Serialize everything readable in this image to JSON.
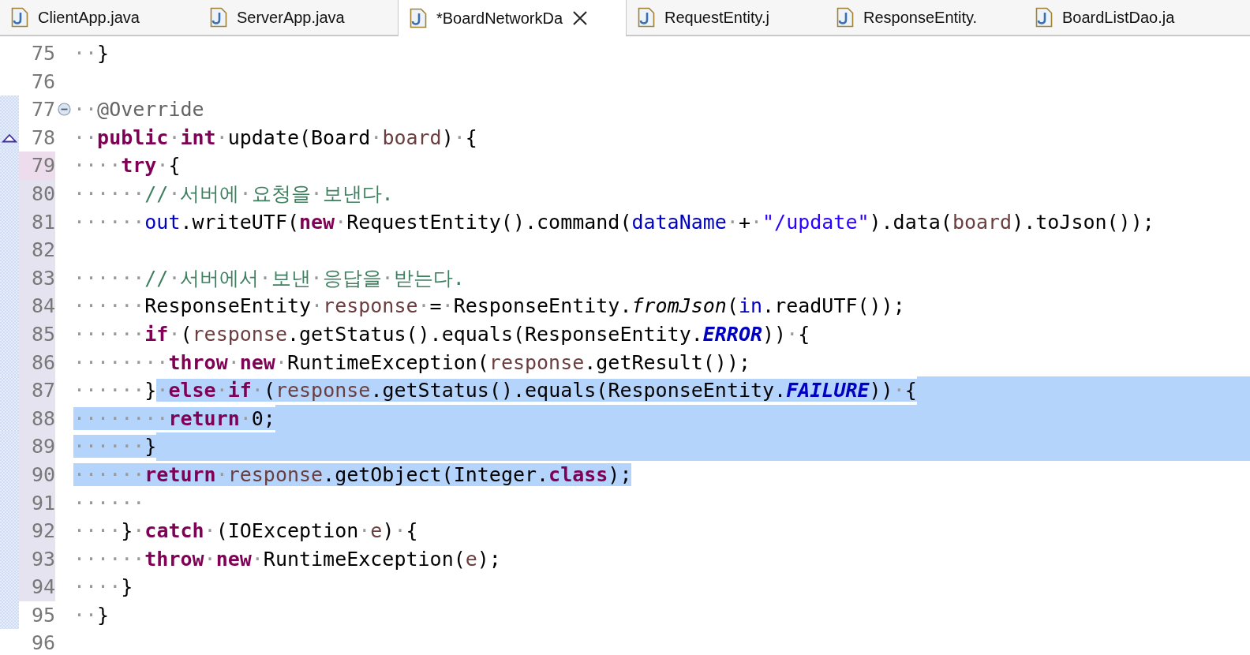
{
  "editor_tabs": [
    {
      "label": "ClientApp.java",
      "selected": false
    },
    {
      "label": "ServerApp.java",
      "selected": false
    },
    {
      "label": "*BoardNetworkDa",
      "selected": true
    },
    {
      "label": "RequestEntity.j",
      "selected": false
    },
    {
      "label": "ResponseEntity.",
      "selected": false
    },
    {
      "label": "BoardListDao.ja",
      "selected": false
    }
  ],
  "lines": [
    {
      "number": "75",
      "changed": false,
      "current": false,
      "range": false,
      "foldable": false,
      "override": false,
      "selected_to_end": false,
      "tokens": [
        {
          "kind": "plain",
          "text": "··}"
        }
      ]
    },
    {
      "number": "76",
      "changed": false,
      "current": false,
      "range": false,
      "foldable": false,
      "override": false,
      "selected_to_end": false
    },
    {
      "number": "77",
      "changed": false,
      "current": false,
      "range": true,
      "foldable": true,
      "override": false,
      "selected_to_end": false,
      "tokens": [
        {
          "kind": "plain",
          "text": "··"
        },
        {
          "kind": "annotation",
          "text": "@Override"
        }
      ]
    },
    {
      "number": "78",
      "changed": false,
      "current": false,
      "range": true,
      "foldable": false,
      "override": true,
      "selected_to_end": false,
      "tokens": [
        {
          "kind": "plain",
          "text": "··"
        },
        {
          "kind": "keyword",
          "text": "public"
        },
        {
          "kind": "plain",
          "text": "·"
        },
        {
          "kind": "keyword",
          "text": "int"
        },
        {
          "kind": "plain",
          "text": "·update(Board·"
        },
        {
          "kind": "local",
          "text": "board"
        },
        {
          "kind": "plain",
          "text": ")·{"
        }
      ]
    },
    {
      "number": "79",
      "changed": true,
      "current": true,
      "range": true,
      "foldable": false,
      "override": false,
      "selected_to_end": false,
      "tokens": [
        {
          "kind": "plain",
          "text": "····"
        },
        {
          "kind": "keyword",
          "text": "try"
        },
        {
          "kind": "plain",
          "text": "·{"
        }
      ]
    },
    {
      "number": "80",
      "changed": true,
      "current": false,
      "range": true,
      "foldable": false,
      "override": false,
      "selected_to_end": false,
      "tokens": [
        {
          "kind": "plain",
          "text": "······"
        },
        {
          "kind": "comment",
          "text": "//·서버에·요청을·보낸다."
        }
      ]
    },
    {
      "number": "81",
      "changed": true,
      "current": false,
      "range": true,
      "foldable": false,
      "override": false,
      "selected_to_end": false,
      "tokens": [
        {
          "kind": "plain",
          "text": "······"
        },
        {
          "kind": "field",
          "text": "out"
        },
        {
          "kind": "plain",
          "text": ".writeUTF("
        },
        {
          "kind": "keyword",
          "text": "new"
        },
        {
          "kind": "plain",
          "text": "·RequestEntity().command("
        },
        {
          "kind": "field",
          "text": "dataName"
        },
        {
          "kind": "plain",
          "text": "·+·"
        },
        {
          "kind": "string",
          "text": "\"/update\""
        },
        {
          "kind": "plain",
          "text": ").data("
        },
        {
          "kind": "local",
          "text": "board"
        },
        {
          "kind": "plain",
          "text": ").toJson());"
        }
      ]
    },
    {
      "number": "82",
      "changed": true,
      "current": false,
      "range": true,
      "foldable": false,
      "override": false,
      "selected_to_end": false
    },
    {
      "number": "83",
      "changed": true,
      "current": false,
      "range": true,
      "foldable": false,
      "override": false,
      "selected_to_end": false,
      "tokens": [
        {
          "kind": "plain",
          "text": "······"
        },
        {
          "kind": "comment",
          "text": "//·서버에서·보낸·응답을·받는다."
        }
      ]
    },
    {
      "number": "84",
      "changed": true,
      "current": false,
      "range": true,
      "foldable": false,
      "override": false,
      "selected_to_end": false,
      "tokens": [
        {
          "kind": "plain",
          "text": "······ResponseEntity·"
        },
        {
          "kind": "local",
          "text": "response"
        },
        {
          "kind": "plain",
          "text": "·=·ResponseEntity."
        },
        {
          "kind": "static_method",
          "text": "fromJson"
        },
        {
          "kind": "plain",
          "text": "("
        },
        {
          "kind": "field",
          "text": "in"
        },
        {
          "kind": "plain",
          "text": ".readUTF());"
        }
      ]
    },
    {
      "number": "85",
      "changed": true,
      "current": false,
      "range": true,
      "foldable": false,
      "override": false,
      "selected_to_end": false,
      "tokens": [
        {
          "kind": "plain",
          "text": "······"
        },
        {
          "kind": "keyword",
          "text": "if"
        },
        {
          "kind": "plain",
          "text": "·("
        },
        {
          "kind": "local",
          "text": "response"
        },
        {
          "kind": "plain",
          "text": ".getStatus().equals(ResponseEntity."
        },
        {
          "kind": "static_field",
          "text": "ERROR"
        },
        {
          "kind": "plain",
          "text": "))·{"
        }
      ]
    },
    {
      "number": "86",
      "changed": true,
      "current": false,
      "range": true,
      "foldable": false,
      "override": false,
      "selected_to_end": false,
      "tokens": [
        {
          "kind": "plain",
          "text": "········"
        },
        {
          "kind": "keyword",
          "text": "throw"
        },
        {
          "kind": "plain",
          "text": "·"
        },
        {
          "kind": "keyword",
          "text": "new"
        },
        {
          "kind": "plain",
          "text": "·RuntimeException("
        },
        {
          "kind": "local",
          "text": "response"
        },
        {
          "kind": "plain",
          "text": ".getResult());"
        }
      ]
    },
    {
      "number": "87",
      "changed": true,
      "current": false,
      "range": true,
      "foldable": false,
      "override": false,
      "selected_to_end": true,
      "tokens": [
        {
          "kind": "plain",
          "text": "······}"
        }
      ],
      "selected_tokens": [
        {
          "kind": "plain",
          "text": "·"
        },
        {
          "kind": "keyword",
          "text": "else"
        },
        {
          "kind": "plain",
          "text": "·"
        },
        {
          "kind": "keyword",
          "text": "if"
        },
        {
          "kind": "plain",
          "text": "·("
        },
        {
          "kind": "local",
          "text": "response"
        },
        {
          "kind": "plain",
          "text": ".getStatus().equals(ResponseEntity."
        },
        {
          "kind": "static_field",
          "text": "FAILURE"
        },
        {
          "kind": "plain",
          "text": "))·{"
        }
      ]
    },
    {
      "number": "88",
      "changed": true,
      "current": false,
      "range": true,
      "foldable": false,
      "override": false,
      "selected_to_end": true,
      "selected_tokens": [
        {
          "kind": "plain",
          "text": "········"
        },
        {
          "kind": "keyword",
          "text": "return"
        },
        {
          "kind": "plain",
          "text": "·0;"
        }
      ]
    },
    {
      "number": "89",
      "changed": true,
      "current": false,
      "range": true,
      "foldable": false,
      "override": false,
      "selected_to_end": true,
      "selected_tokens": [
        {
          "kind": "plain",
          "text": "······}"
        }
      ]
    },
    {
      "number": "90",
      "changed": true,
      "current": false,
      "range": true,
      "foldable": false,
      "override": false,
      "selected_to_end": false,
      "selected_tokens": [
        {
          "kind": "plain",
          "text": "······"
        },
        {
          "kind": "keyword",
          "text": "return"
        },
        {
          "kind": "plain",
          "text": "·"
        },
        {
          "kind": "local",
          "text": "response"
        },
        {
          "kind": "plain",
          "text": ".getObject(Integer."
        },
        {
          "kind": "keyword",
          "text": "class"
        },
        {
          "kind": "plain",
          "text": ");"
        }
      ]
    },
    {
      "number": "91",
      "changed": true,
      "current": false,
      "range": true,
      "foldable": false,
      "override": false,
      "selected_to_end": false,
      "tokens": [
        {
          "kind": "plain",
          "text": "······"
        }
      ]
    },
    {
      "number": "92",
      "changed": true,
      "current": false,
      "range": true,
      "foldable": false,
      "override": false,
      "selected_to_end": false,
      "tokens": [
        {
          "kind": "plain",
          "text": "····}·"
        },
        {
          "kind": "keyword",
          "text": "catch"
        },
        {
          "kind": "plain",
          "text": "·(IOException·"
        },
        {
          "kind": "local",
          "text": "e"
        },
        {
          "kind": "plain",
          "text": ")·{"
        }
      ]
    },
    {
      "number": "93",
      "changed": true,
      "current": false,
      "range": true,
      "foldable": false,
      "override": false,
      "selected_to_end": false,
      "tokens": [
        {
          "kind": "plain",
          "text": "······"
        },
        {
          "kind": "keyword",
          "text": "throw"
        },
        {
          "kind": "plain",
          "text": "·"
        },
        {
          "kind": "keyword",
          "text": "new"
        },
        {
          "kind": "plain",
          "text": "·RuntimeException("
        },
        {
          "kind": "local",
          "text": "e"
        },
        {
          "kind": "plain",
          "text": ");"
        }
      ]
    },
    {
      "number": "94",
      "changed": true,
      "current": false,
      "range": true,
      "foldable": false,
      "override": false,
      "selected_to_end": false,
      "tokens": [
        {
          "kind": "plain",
          "text": "····}"
        }
      ]
    },
    {
      "number": "95",
      "changed": false,
      "current": false,
      "range": true,
      "foldable": false,
      "override": false,
      "selected_to_end": false,
      "tokens": [
        {
          "kind": "plain",
          "text": "··}"
        }
      ]
    },
    {
      "number": "96",
      "changed": false,
      "current": false,
      "range": false,
      "foldable": false,
      "override": false,
      "selected_to_end": false
    }
  ]
}
